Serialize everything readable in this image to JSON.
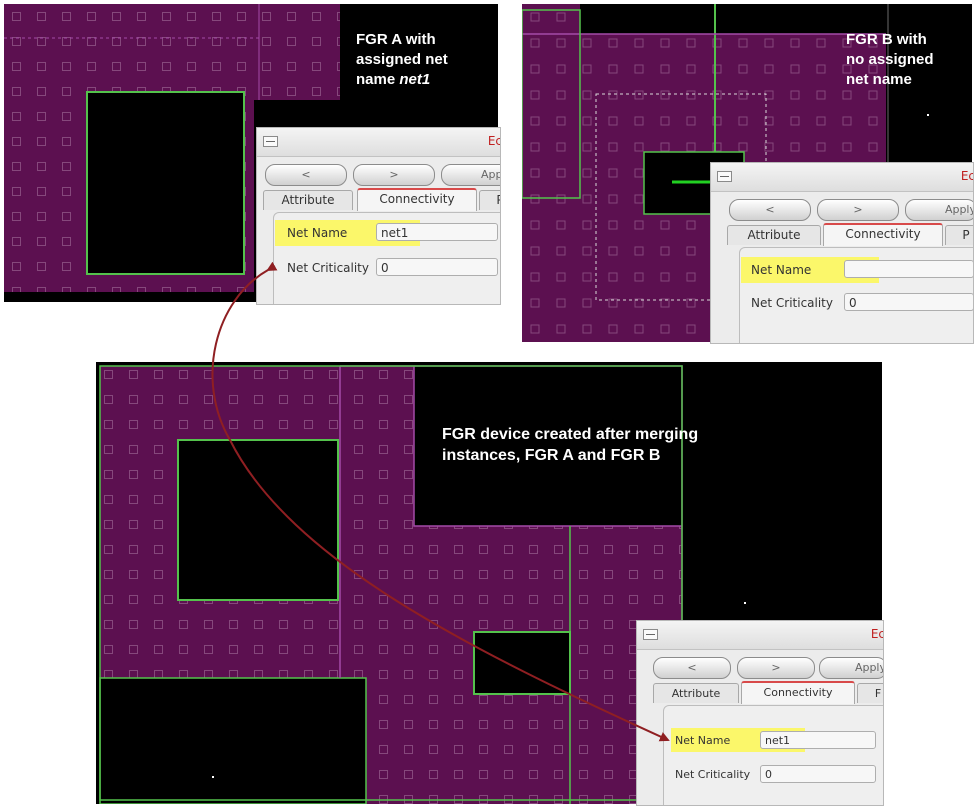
{
  "colors": {
    "canvas": "#000000",
    "fill": "#5c1050",
    "grid": "#86487c",
    "outline": "#54c24c",
    "boundary": "#a44aa8",
    "arrow": "#8f1f22",
    "highlight": "#fbf76a",
    "title": "#c02020"
  },
  "icons": [
    "window-menu-icon",
    "arrow-icon"
  ],
  "panel_a": {
    "caption_line1": "FGR A with",
    "caption_line2": "assigned net",
    "caption_line3_prefix": "name ",
    "caption_line3_em": "net1"
  },
  "panel_b": {
    "caption_line1": "FGR B with",
    "caption_line2": "no assigned",
    "caption_line3": "net name"
  },
  "panel_c": {
    "caption_line1": "FGR device created after merging",
    "caption_line2": "instances, FGR A and FGR B"
  },
  "dialogs": [
    {
      "title": "Ec",
      "prev_label": "<",
      "next_label": ">",
      "apply_label": "Apply",
      "tab_attribute": "Attribute",
      "tab_connectivity": "Connectivity",
      "tab_third": "P",
      "net_name_label": "Net Name",
      "net_name_value": "net1",
      "net_criticality_label": "Net Criticality",
      "net_criticality_value": "0"
    },
    {
      "title": "Ec",
      "prev_label": "<",
      "next_label": ">",
      "apply_label": "Apply",
      "tab_attribute": "Attribute",
      "tab_connectivity": "Connectivity",
      "tab_third": "P",
      "net_name_label": "Net Name",
      "net_name_value": "",
      "net_criticality_label": "Net Criticality",
      "net_criticality_value": "0"
    },
    {
      "title": "Ec",
      "prev_label": "<",
      "next_label": ">",
      "apply_label": "Apply",
      "tab_attribute": "Attribute",
      "tab_connectivity": "Connectivity",
      "tab_third": "F",
      "net_name_label": "Net Name",
      "net_name_value": "net1",
      "net_criticality_label": "Net Criticality",
      "net_criticality_value": "0"
    }
  ]
}
